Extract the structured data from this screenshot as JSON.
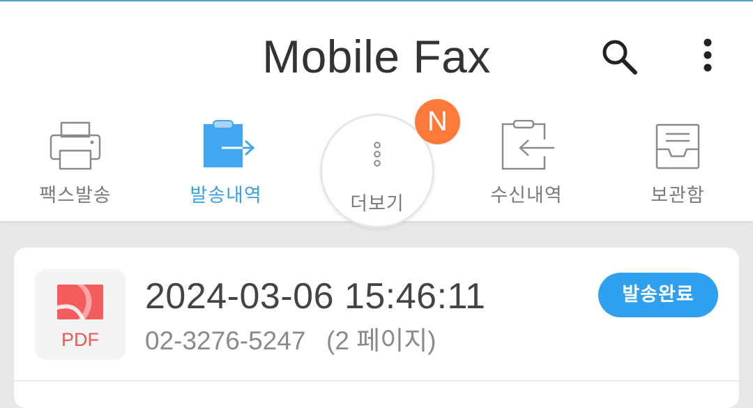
{
  "header": {
    "title": "Mobile Fax",
    "search_icon": "search-icon",
    "menu_icon": "more-vertical-icon"
  },
  "nav": {
    "items": [
      {
        "label": "팩스발송",
        "icon": "printer-icon",
        "active": false
      },
      {
        "label": "발송내역",
        "icon": "sent-clipboard-icon",
        "active": true
      },
      {
        "label": "더보기",
        "icon": "more-dots-icon",
        "active": false
      },
      {
        "label": "수신내역",
        "icon": "received-clipboard-icon",
        "active": false
      },
      {
        "label": "보관함",
        "icon": "archive-tray-icon",
        "active": false
      }
    ],
    "new_badge": "N"
  },
  "fax_list": {
    "items": [
      {
        "file_type": "PDF",
        "datetime": "2024-03-06 15:46:11",
        "number": "02-3276-5247",
        "pages": "(2 페이지)",
        "status": "발송완료"
      }
    ]
  },
  "colors": {
    "accent": "#3a9fe4",
    "status_badge": "#2f9ff0",
    "new_badge": "#ff7a3a",
    "pdf_red": "#e25a5a"
  }
}
